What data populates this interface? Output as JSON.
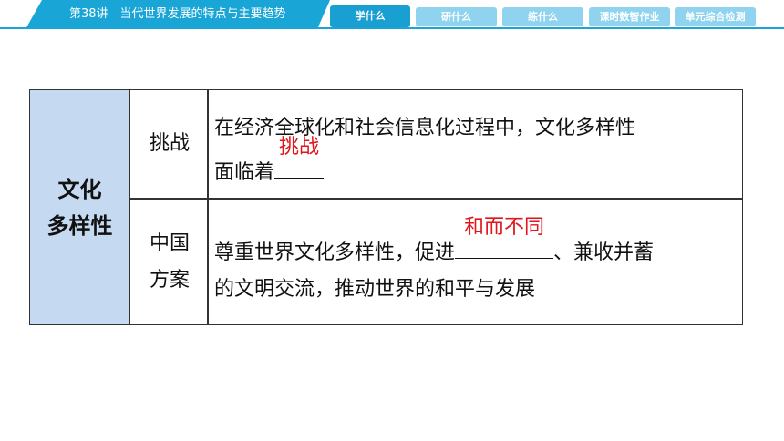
{
  "header": {
    "lesson_title": "第38讲　当代世界发展的特点与主要趋势",
    "tabs": [
      {
        "label": "学什么",
        "active": true
      },
      {
        "label": "研什么",
        "active": false
      },
      {
        "label": "练什么",
        "active": false
      },
      {
        "label": "课时数智作业",
        "active": false
      },
      {
        "label": "单元综合检测",
        "active": false
      }
    ]
  },
  "table": {
    "category_line1": "文化",
    "category_line2": "多样性",
    "rows": [
      {
        "label": "挑战",
        "line1": "在经济全球化和社会信息化过程中，文化多样性",
        "line2_before": "面临着",
        "answer": "挑战",
        "line2_after": ""
      },
      {
        "label_line1": "中国",
        "label_line2": "方案",
        "line1_before": "尊重世界文化多样性，促进",
        "answer": "和而不同",
        "line1_after": "、兼收并蓄",
        "line2": "的文明交流，推动世界的和平与发展"
      }
    ]
  },
  "colors": {
    "accent": "#19a6d6",
    "tab_inactive": "#8fd3ef",
    "category_bg": "#c5daf0",
    "answer_text": "#e0161b"
  }
}
